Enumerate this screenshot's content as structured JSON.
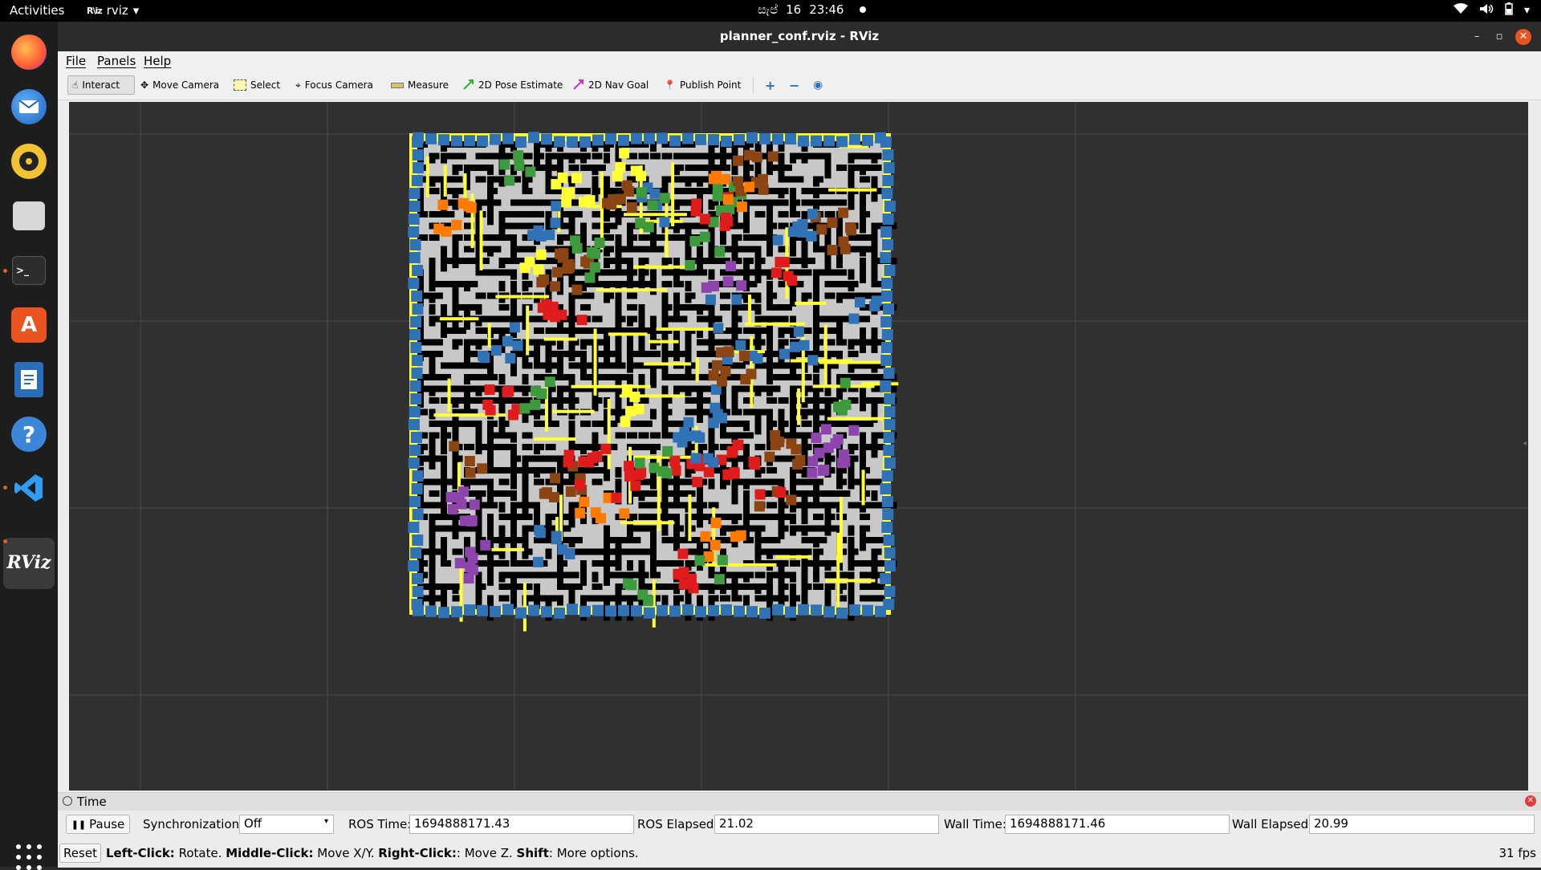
{
  "topbar": {
    "activities": "Activities",
    "app_name": "rviz",
    "app_logo": "R\\iz",
    "clock_day": "සැප්",
    "clock_date": "16",
    "clock_time": "23:46",
    "tray_icons": [
      "wifi-icon",
      "volume-icon",
      "battery-icon",
      "chevron-down-icon"
    ]
  },
  "dock": {
    "items": [
      "firefox",
      "thunderbird",
      "rhythmbox",
      "files",
      "terminal",
      "app-center",
      "libreoffice-writer",
      "help",
      "vscode",
      "rviz"
    ],
    "running": [
      "terminal",
      "vscode",
      "rviz"
    ],
    "rviz_label": "RViz",
    "terminal_label": ">_"
  },
  "window": {
    "title": "planner_conf.rviz - RViz",
    "menu": [
      "File",
      "Panels",
      "Help"
    ]
  },
  "toolbar": {
    "tools": [
      "Interact",
      "Move Camera",
      "Select",
      "Focus Camera",
      "Measure",
      "2D Pose Estimate",
      "2D Nav Goal",
      "Publish Point"
    ],
    "active_tool": "Interact",
    "extra_icons": [
      "plus-icon",
      "minus-icon",
      "eye-icon"
    ]
  },
  "time_panel": {
    "title": "Time",
    "pause_label": "Pause",
    "sync_label": "Synchronization:",
    "sync_value": "Off",
    "ros_time_label": "ROS Time:",
    "ros_time": "1694888171.43",
    "ros_elapsed_label": "ROS Elapsed:",
    "ros_elapsed": "21.02",
    "wall_time_label": "Wall Time:",
    "wall_time": "1694888171.46",
    "wall_elapsed_label": "Wall Elapsed:",
    "wall_elapsed": "20.99"
  },
  "status": {
    "reset_label": "Reset",
    "left_click": "Left-Click:",
    "left_click_action": " Rotate. ",
    "middle_click": "Middle-Click:",
    "middle_click_action": " Move X/Y. ",
    "right_click": "Right-Click:",
    "right_click_action": ": Move Z. ",
    "shift": "Shift",
    "shift_action": ": More options.",
    "fps": "31 fps"
  },
  "colors": {
    "viewport_bg": "#303030",
    "grid": "#4a4a4a",
    "maze_wall": "#000000",
    "maze_corridor": "#c8c8c8",
    "path_yellow": "#ffff33",
    "blue": "#2f72b5",
    "green": "#3d9b3d",
    "red": "#e01b1b",
    "orange": "#ff7a00",
    "purple": "#8e44ad",
    "brown": "#8b4513",
    "accent": "#e95420"
  }
}
